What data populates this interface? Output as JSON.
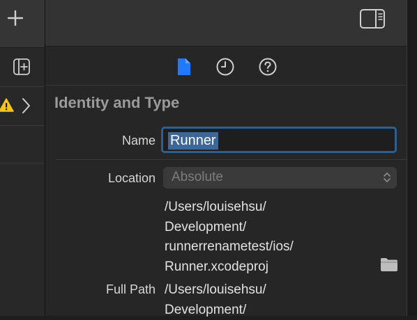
{
  "toolbar": {
    "add_icon": "plus-icon",
    "panel_icon": "sidebar-right-icon"
  },
  "navigator": {
    "add_icon": "plus-square-icon",
    "warning_icon": "warning-triangle-icon",
    "expand_icon": "chevron-right-icon"
  },
  "inspector": {
    "tabs": [
      {
        "icon": "document-icon",
        "selected": true
      },
      {
        "icon": "clock-icon",
        "selected": false
      },
      {
        "icon": "question-circle-icon",
        "selected": false
      }
    ],
    "section_title": "Identity and Type",
    "name_label": "Name",
    "name_value": "Runner",
    "location_label": "Location",
    "location_value": "Absolute",
    "path_lines": [
      "/Users/louisehsu/",
      "Development/",
      "runnerrenametest/ios/",
      "Runner.xcodeproj"
    ],
    "full_path_label": "Full Path",
    "full_path_lines": [
      "/Users/louisehsu/",
      "Development/"
    ]
  },
  "colors": {
    "accent": "#1f7aff",
    "selection": "#3d6797",
    "focus_ring": "#2e5f91",
    "warning": "#f5c518"
  }
}
